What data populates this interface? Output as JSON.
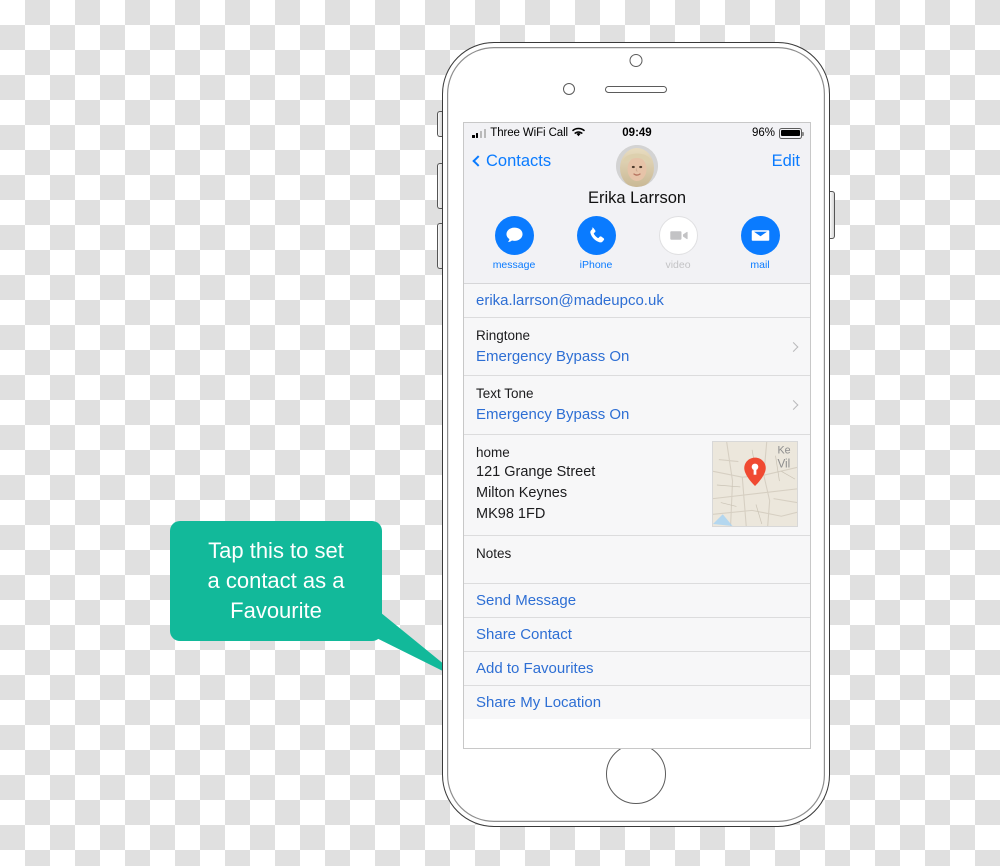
{
  "phone": {
    "device_label": "iphone-frame",
    "buttons": [
      "silent-switch",
      "volume-up",
      "volume-down",
      "power"
    ]
  },
  "status_bar": {
    "carrier": "Three WiFi Call",
    "wifi_icon": "wifi-icon",
    "signal_icon": "signal-bars-icon",
    "time": "09:49",
    "battery_percent": "96%",
    "battery_icon": "battery-full-icon"
  },
  "nav": {
    "back_label": "Contacts",
    "back_icon": "chevron-left-icon",
    "edit_label": "Edit",
    "avatar": "contact-avatar"
  },
  "contact": {
    "name": "Erika Larrson",
    "actions": [
      {
        "label": "message",
        "icon": "message-bubble-icon",
        "enabled": true
      },
      {
        "label": "iPhone",
        "icon": "phone-handset-icon",
        "enabled": true
      },
      {
        "label": "video",
        "icon": "video-camera-icon",
        "enabled": false
      },
      {
        "label": "mail",
        "icon": "envelope-icon",
        "enabled": true
      }
    ],
    "email": "erika.larrson@madeupco.uk",
    "ringtone": {
      "label": "Ringtone",
      "value": "Emergency Bypass On"
    },
    "text_tone": {
      "label": "Text Tone",
      "value": "Emergency Bypass On"
    },
    "address": {
      "label": "home",
      "line1": "121 Grange Street",
      "line2": "Milton Keynes",
      "line3": "MK98 1FD",
      "map_labels": [
        "Ke",
        "Vil"
      ],
      "map_pin": "map-pin-icon"
    },
    "notes_label": "Notes",
    "links": [
      "Send Message",
      "Share Contact",
      "Add to Favourites",
      "Share My Location"
    ]
  },
  "callout": {
    "line1": "Tap this to set",
    "line2": "a contact as a",
    "line3": "Favourite",
    "color": "#12b99a",
    "text_color": "#ffffff",
    "points_to": "Add to Favourites"
  },
  "colors": {
    "accent_blue": "#0a7bff",
    "link_blue": "#2e6fd4",
    "teal": "#12b99a",
    "pin_red": "#f04a32",
    "list_bg": "#f7f7f8",
    "header_bg": "#f2f2f5"
  }
}
